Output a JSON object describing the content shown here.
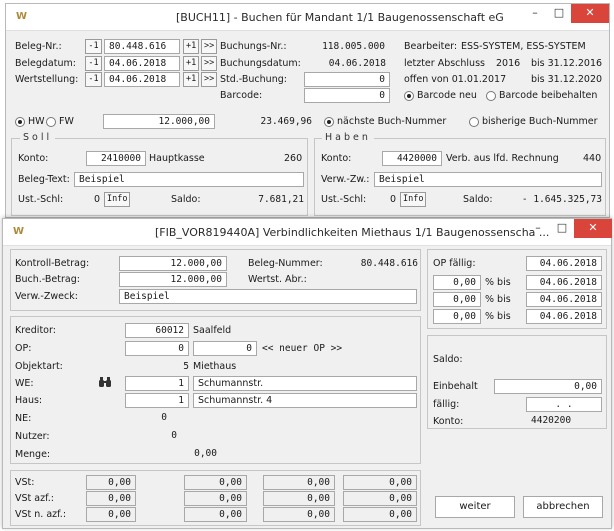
{
  "win1": {
    "logo": "W",
    "title": "[BUCH11] - Buchen für Mandant 1/1 Baugenossenschaft eG",
    "controls": {
      "minimize": "–",
      "maximize": "□",
      "close": "✕"
    },
    "beleg_nr": {
      "label": "Beleg-Nr.:",
      "minus": "-1",
      "value": "80.448.616",
      "plus": "+1",
      "next": ">>"
    },
    "belegdatum": {
      "label": "Belegdatum:",
      "minus": "-1",
      "value": "04.06.2018",
      "plus": "+1",
      "next": ">>"
    },
    "wertstellung": {
      "label": "Wertstellung:",
      "minus": "-1",
      "value": "04.06.2018",
      "plus": "+1",
      "next": ">>"
    },
    "buchungs_nr": {
      "label": "Buchungs-Nr.:",
      "value": "118.005.000"
    },
    "buchungsdatum": {
      "label": "Buchungsdatum:",
      "value": "04.06.2018"
    },
    "std_buchung": {
      "label": "Std.-Buchung:",
      "value": "0"
    },
    "barcode": {
      "label": "Barcode:",
      "value": "0"
    },
    "bearbeiter": {
      "label": "Bearbeiter:",
      "value": "ESS-SYSTEM, ESS-SYSTEM"
    },
    "abschluss": {
      "label": "letzter Abschluss",
      "year": "2016",
      "until": "bis 31.12.2016"
    },
    "offen": {
      "label": "offen von 01.01.2017",
      "until": "bis 31.12.2020"
    },
    "barcode_neu": "Barcode neu",
    "barcode_beibehalten": "Barcode beibehalten",
    "hw": "HW",
    "fw": "FW",
    "amount": "12.000,00",
    "amount2": "23.469,96",
    "naechste": "nächste Buch-Nummer",
    "bisherige": "bisherige Buch-Nummer",
    "soll": {
      "caption": "Soll",
      "konto_label": "Konto:",
      "konto_value": "2410000",
      "konto_name": "Hauptkasse",
      "konto_code": "260",
      "text_label": "Beleg-Text:",
      "text_value": "Beispiel",
      "ust_label": "Ust.-Schl:",
      "ust_value": "0",
      "info": "Info",
      "saldo_label": "Saldo:",
      "saldo_value": "7.681,21"
    },
    "haben": {
      "caption": "Haben",
      "konto_label": "Konto:",
      "konto_value": "4420000",
      "konto_name": "Verb. aus lfd. Rechnung",
      "konto_code": "440",
      "text_label": "Verw.-Zw.:",
      "text_value": "Beispiel",
      "ust_label": "Ust.-Schl:",
      "ust_value": "0",
      "info": "Info",
      "saldo_label": "Saldo:",
      "saldo_value": "- 1.645.325,73"
    }
  },
  "win2": {
    "logo": "W",
    "title": "[FIB_VOR819440A]  Verbindlichkeiten Miethaus  1/1 Baugenossenscha ...",
    "controls": {
      "minimize": "–",
      "maximize": "□",
      "close": "✕"
    },
    "kontroll_betrag": {
      "label": "Kontroll-Betrag:",
      "value": "12.000,00"
    },
    "buch_betrag": {
      "label": "Buch.-Betrag:",
      "value": "12.000,00"
    },
    "verw_zweck": {
      "label": "Verw.-Zweck:",
      "value": "Beispiel"
    },
    "beleg_nummer": {
      "label": "Beleg-Nummer:",
      "value": "80.448.616"
    },
    "wertst_abr": {
      "label": "Wertst. Abr.:",
      "value": ""
    },
    "op_faellig": {
      "label": "OP fällig:",
      "value": "04.06.2018",
      "rows": [
        {
          "amount": "0,00",
          "label": "% bis",
          "date": "04.06.2018"
        },
        {
          "amount": "0,00",
          "label": "% bis",
          "date": "04.06.2018"
        },
        {
          "amount": "0,00",
          "label": "% bis",
          "date": "04.06.2018"
        }
      ]
    },
    "kreditor": {
      "label": "Kreditor:",
      "value": "60012",
      "name": "Saalfeld"
    },
    "op": {
      "label": "OP:",
      "value1": "0",
      "value2": "0",
      "hint": "<< neuer OP >>"
    },
    "objektart": {
      "label": "Objektart:",
      "value": "5",
      "name": "Miethaus"
    },
    "we": {
      "label": "WE:",
      "value": "1",
      "name": "Schumannstr."
    },
    "haus": {
      "label": "Haus:",
      "value": "1",
      "name": "Schumannstr. 4"
    },
    "ne": {
      "label": "NE:",
      "value": "0"
    },
    "nutzer": {
      "label": "Nutzer:",
      "value": "0"
    },
    "menge": {
      "label": "Menge:",
      "value": "0,00"
    },
    "saldo_label": "Saldo:",
    "einbehalt": {
      "label": "Einbehalt",
      "value": "0,00"
    },
    "faellig": {
      "label": "fällig:",
      "value": ". ."
    },
    "konto": {
      "label": "Konto:",
      "value": "4420200"
    },
    "vst": {
      "label": "VSt:",
      "values": [
        "0,00",
        "0,00",
        "0,00",
        "0,00"
      ]
    },
    "vst_azf": {
      "label": "VSt azf.:",
      "values": [
        "0,00",
        "0,00",
        "0,00",
        "0,00"
      ]
    },
    "vst_n_azf": {
      "label": "VSt n. azf.:",
      "values": [
        "0,00",
        "0,00",
        "0,00",
        "0,00"
      ]
    },
    "weiter": "weiter",
    "abbrechen": "abbrechen"
  },
  "colors": {
    "close": "#d9453a",
    "window_bg": "#f0f0f0",
    "logo": "#b08a3c"
  },
  "icons": {
    "search": "binoculars-icon"
  }
}
